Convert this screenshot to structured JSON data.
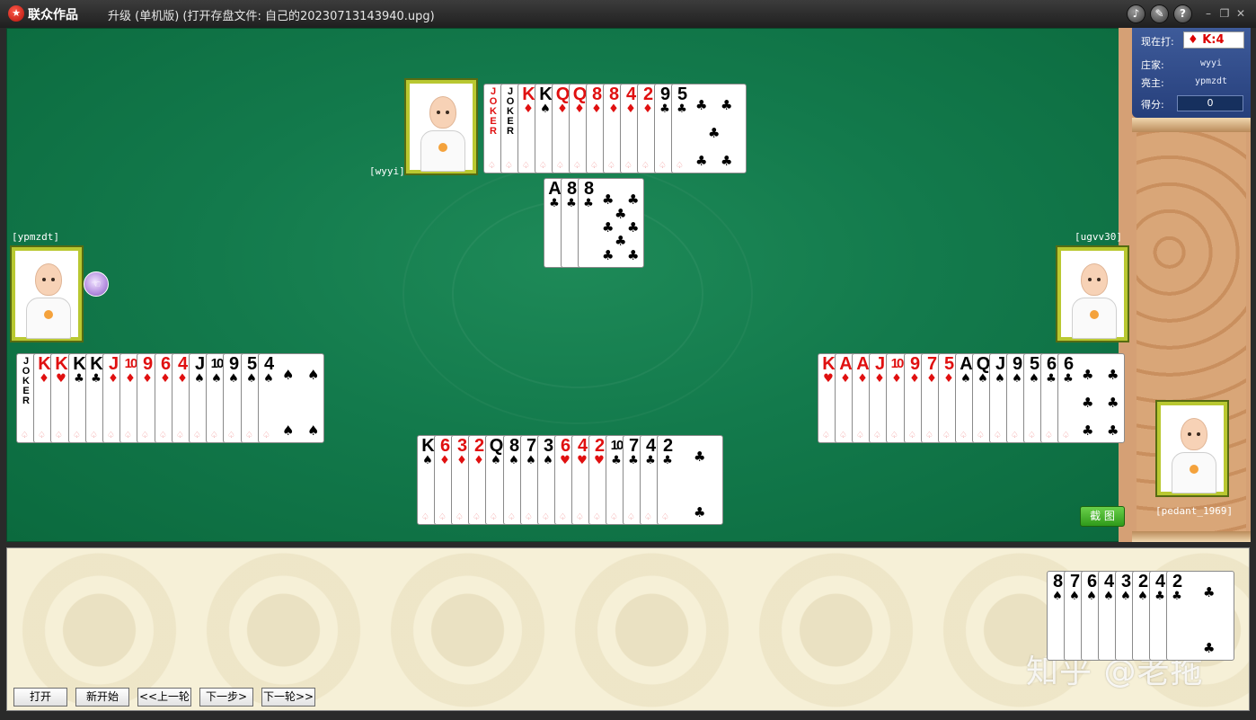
{
  "window": {
    "brand": "联众作品",
    "title": "升级 (单机版) (打开存盘文件: 自己的20230713143940.upg)",
    "controls": [
      "speaker-icon",
      "tools-icon",
      "help-icon",
      "minimize",
      "restore",
      "close"
    ]
  },
  "info_panel": {
    "now_playing_label": "现在打:",
    "now_playing_value": "K:4",
    "trump_suit_symbol": "♦",
    "dealer_label": "庄家:",
    "dealer_value": "wyyi",
    "trump_caller_label": "亮主:",
    "trump_caller_value": "ypmzdt",
    "score_label": "得分:",
    "score_value": "0"
  },
  "players": {
    "top": "[wyyi]",
    "left": "[ypmzdt]",
    "right": "[ugvv30]",
    "self": "[pedant_1969]"
  },
  "screenshot_button": "截 图",
  "buttons": {
    "open": "打开",
    "restart": "新开始",
    "prev_round": "<<上一轮",
    "next_step": "下一步>",
    "next_round": "下一轮>>"
  },
  "watermark": "知乎 @老拖",
  "colors": {
    "red": "#e01010",
    "black": "#000000",
    "felt": "#137a4c"
  },
  "hands": {
    "top": [
      {
        "rank": "JOKER",
        "suit": "",
        "color": "red"
      },
      {
        "rank": "JOKER",
        "suit": "",
        "color": "black"
      },
      {
        "rank": "K",
        "suit": "♦",
        "color": "red"
      },
      {
        "rank": "K",
        "suit": "♠",
        "color": "black"
      },
      {
        "rank": "Q",
        "suit": "♦",
        "color": "red"
      },
      {
        "rank": "Q",
        "suit": "♦",
        "color": "red"
      },
      {
        "rank": "8",
        "suit": "♦",
        "color": "red"
      },
      {
        "rank": "8",
        "suit": "♦",
        "color": "red"
      },
      {
        "rank": "4",
        "suit": "♦",
        "color": "red"
      },
      {
        "rank": "2",
        "suit": "♦",
        "color": "red"
      },
      {
        "rank": "9",
        "suit": "♣",
        "color": "black"
      },
      {
        "rank": "5",
        "suit": "♣",
        "color": "black"
      }
    ],
    "top_played": [
      {
        "rank": "A",
        "suit": "♣",
        "color": "black"
      },
      {
        "rank": "8",
        "suit": "♣",
        "color": "black"
      },
      {
        "rank": "8",
        "suit": "♣",
        "color": "black"
      }
    ],
    "left": [
      {
        "rank": "JOKER",
        "suit": "",
        "color": "black"
      },
      {
        "rank": "K",
        "suit": "♦",
        "color": "red"
      },
      {
        "rank": "K",
        "suit": "♥",
        "color": "red"
      },
      {
        "rank": "K",
        "suit": "♣",
        "color": "black"
      },
      {
        "rank": "K",
        "suit": "♣",
        "color": "black"
      },
      {
        "rank": "J",
        "suit": "♦",
        "color": "red"
      },
      {
        "rank": "10",
        "suit": "♦",
        "color": "red"
      },
      {
        "rank": "9",
        "suit": "♦",
        "color": "red"
      },
      {
        "rank": "6",
        "suit": "♦",
        "color": "red"
      },
      {
        "rank": "4",
        "suit": "♦",
        "color": "red"
      },
      {
        "rank": "J",
        "suit": "♠",
        "color": "black"
      },
      {
        "rank": "10",
        "suit": "♠",
        "color": "black"
      },
      {
        "rank": "9",
        "suit": "♠",
        "color": "black"
      },
      {
        "rank": "5",
        "suit": "♠",
        "color": "black"
      },
      {
        "rank": "4",
        "suit": "♠",
        "color": "black"
      }
    ],
    "right": [
      {
        "rank": "K",
        "suit": "♥",
        "color": "red"
      },
      {
        "rank": "A",
        "suit": "♦",
        "color": "red"
      },
      {
        "rank": "A",
        "suit": "♦",
        "color": "red"
      },
      {
        "rank": "J",
        "suit": "♦",
        "color": "red"
      },
      {
        "rank": "10",
        "suit": "♦",
        "color": "red"
      },
      {
        "rank": "9",
        "suit": "♦",
        "color": "red"
      },
      {
        "rank": "7",
        "suit": "♦",
        "color": "red"
      },
      {
        "rank": "5",
        "suit": "♦",
        "color": "red"
      },
      {
        "rank": "A",
        "suit": "♠",
        "color": "black"
      },
      {
        "rank": "Q",
        "suit": "♠",
        "color": "black"
      },
      {
        "rank": "J",
        "suit": "♠",
        "color": "black"
      },
      {
        "rank": "9",
        "suit": "♠",
        "color": "black"
      },
      {
        "rank": "5",
        "suit": "♠",
        "color": "black"
      },
      {
        "rank": "6",
        "suit": "♣",
        "color": "black"
      },
      {
        "rank": "6",
        "suit": "♣",
        "color": "black"
      }
    ],
    "bottom": [
      {
        "rank": "K",
        "suit": "♠",
        "color": "black"
      },
      {
        "rank": "6",
        "suit": "♦",
        "color": "red"
      },
      {
        "rank": "3",
        "suit": "♦",
        "color": "red"
      },
      {
        "rank": "2",
        "suit": "♦",
        "color": "red"
      },
      {
        "rank": "Q",
        "suit": "♠",
        "color": "black"
      },
      {
        "rank": "8",
        "suit": "♠",
        "color": "black"
      },
      {
        "rank": "7",
        "suit": "♠",
        "color": "black"
      },
      {
        "rank": "3",
        "suit": "♠",
        "color": "black"
      },
      {
        "rank": "6",
        "suit": "♥",
        "color": "red"
      },
      {
        "rank": "4",
        "suit": "♥",
        "color": "red"
      },
      {
        "rank": "2",
        "suit": "♥",
        "color": "red"
      },
      {
        "rank": "10",
        "suit": "♣",
        "color": "black"
      },
      {
        "rank": "7",
        "suit": "♣",
        "color": "black"
      },
      {
        "rank": "4",
        "suit": "♣",
        "color": "black"
      },
      {
        "rank": "2",
        "suit": "♣",
        "color": "black"
      }
    ],
    "kitty": [
      {
        "rank": "8",
        "suit": "♠",
        "color": "black"
      },
      {
        "rank": "7",
        "suit": "♠",
        "color": "black"
      },
      {
        "rank": "6",
        "suit": "♠",
        "color": "black"
      },
      {
        "rank": "4",
        "suit": "♠",
        "color": "black"
      },
      {
        "rank": "3",
        "suit": "♠",
        "color": "black"
      },
      {
        "rank": "2",
        "suit": "♠",
        "color": "black"
      },
      {
        "rank": "4",
        "suit": "♣",
        "color": "black"
      },
      {
        "rank": "2",
        "suit": "♣",
        "color": "black"
      }
    ]
  }
}
